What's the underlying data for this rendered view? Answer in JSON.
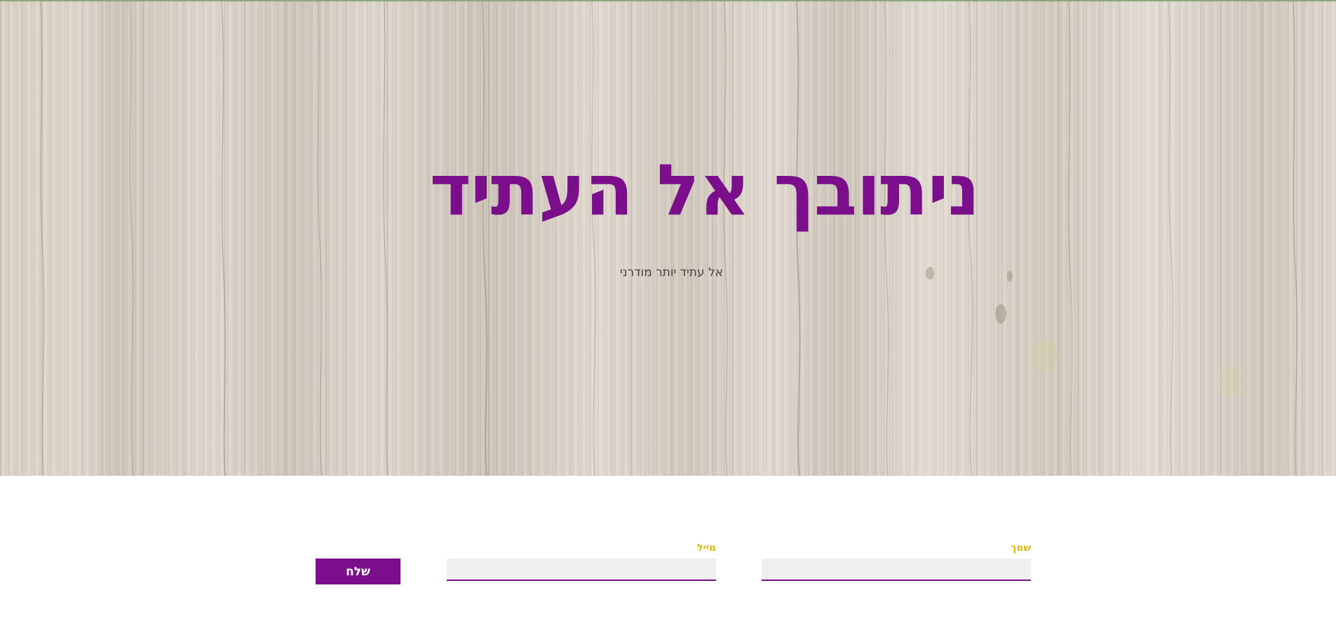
{
  "hero": {
    "title": "ניתובך אל העתיד",
    "subtitle": "אל עתיד יותר מודרני"
  },
  "form": {
    "name_label": "שמך",
    "name_value": "",
    "email_label": "מייל",
    "email_value": "",
    "submit_label": "שלח"
  },
  "colors": {
    "accent": "#7b0f8b",
    "label": "#e3b60a",
    "input_bg": "#efefef"
  }
}
